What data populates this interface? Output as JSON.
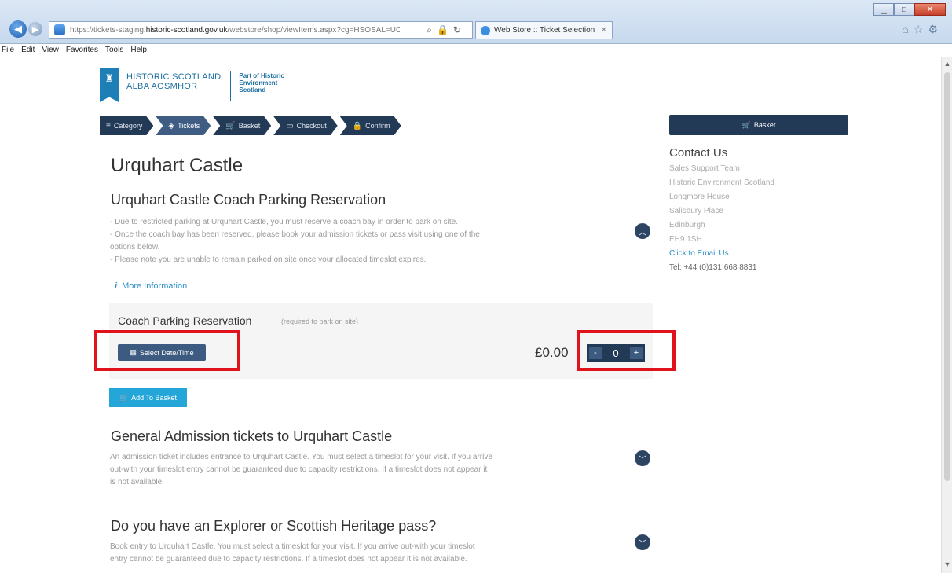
{
  "browser": {
    "url_prefix": "https://tickets-staging.",
    "url_domain": "historic-scotland.gov.uk",
    "url_rest": "/webstore/shop/viewItems.aspx?cg=HSOSAL=UC",
    "tab_title": "Web Store :: Ticket Selection",
    "menu": [
      "File",
      "Edit",
      "View",
      "Favorites",
      "Tools",
      "Help"
    ]
  },
  "logo": {
    "line1": "HISTORIC SCOTLAND",
    "line2": "ALBA AOSMHOR",
    "sub1": "Part of Historic",
    "sub2": "Environment",
    "sub3": "Scotland"
  },
  "steps": [
    {
      "icon": "≡",
      "label": "Category"
    },
    {
      "icon": "◈",
      "label": "Tickets"
    },
    {
      "icon": "🛒",
      "label": "Basket"
    },
    {
      "icon": "▭",
      "label": "Checkout"
    },
    {
      "icon": "🔒",
      "label": "Confirm"
    }
  ],
  "page": {
    "title": "Urquhart Castle"
  },
  "coach": {
    "title": "Urquhart Castle Coach Parking Reservation",
    "lines": [
      "- Due to restricted parking at Urquhart Castle, you must reserve a coach bay in order to park on site.",
      "- Once the coach bay has been reserved, please book your admission tickets or pass visit using one of the",
      "options below.",
      "- Please note you are unable to remain parked on site once your allocated timeslot expires."
    ],
    "more_info": "More Information",
    "product_name": "Coach Parking Reservation",
    "product_note": "(required to park on site)",
    "select_date_label": "Select Date/Time",
    "price": "£0.00",
    "qty_minus": "-",
    "qty_value": "0",
    "qty_plus": "+",
    "add_to_basket_label": "Add To Basket"
  },
  "general": {
    "title": "General Admission tickets to Urquhart Castle",
    "lines": [
      "An admission ticket includes entrance to Urquhart Castle. You must select a timeslot for your visit. If you arrive",
      "out-with your timeslot entry cannot be guaranteed due to capacity restrictions. If a timeslot does not appear it",
      "is not available."
    ]
  },
  "explorer": {
    "title": "Do you have an Explorer or Scottish Heritage pass?",
    "lines": [
      "Book entry to Urquhart Castle. You must select a timeslot for your visit. If you arrive out-with your timeslot",
      "entry cannot be guaranteed due to capacity restrictions. If a timeslot does not appear it is not available."
    ]
  },
  "sidebar": {
    "basket_label": "Basket",
    "contact_title": "Contact Us",
    "contact_lines": [
      "Sales Support Team",
      "Historic Environment Scotland",
      "Longmore House",
      "Salisbury Place",
      "Edinburgh",
      "EH9 1SH"
    ],
    "email_label": "Click to Email Us",
    "tel": "Tel: +44 (0)131 668 8831"
  }
}
